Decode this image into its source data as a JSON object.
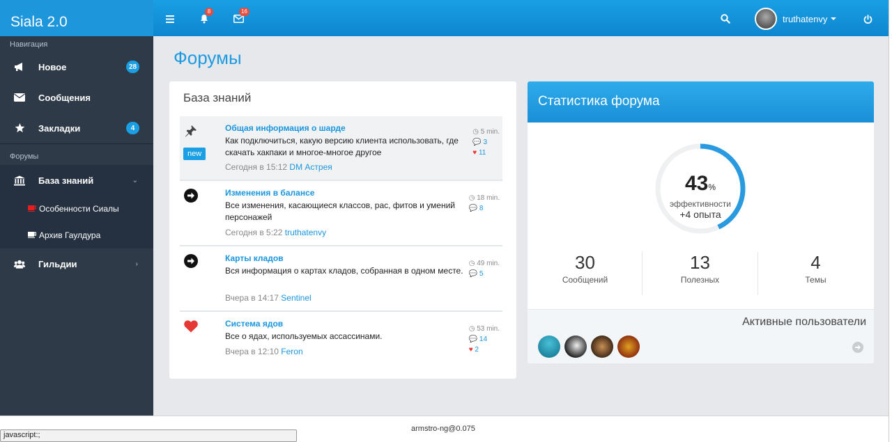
{
  "brand": "Siala 2.0",
  "topbar": {
    "notifications_count": "8",
    "messages_count": "16",
    "username": "truthatenvy"
  },
  "sidebar": {
    "nav_heading": "Навигация",
    "items": [
      {
        "label": "Новое",
        "badge": "28"
      },
      {
        "label": "Сообщения"
      },
      {
        "label": "Закладки",
        "badge": "4"
      }
    ],
    "forums_heading": "Форумы",
    "knowledge": "База знаний",
    "subitems": [
      "Особенности Сиалы",
      "Архив Гаулдура"
    ],
    "guilds": "Гильдии"
  },
  "page_title": "Форумы",
  "panel": {
    "title": "База знаний",
    "new_label": "new",
    "topics": [
      {
        "title": "Общая информация о шарде",
        "desc": "Как подключиться, какую версию клиента использовать, где скачать хакпаки и многое-многое другое",
        "time": "Сегодня в 15:12",
        "author": "DM Астрея",
        "ago": "5 min.",
        "replies": "3",
        "likes": "11"
      },
      {
        "title": "Изменения в балансе",
        "desc": "Все изменения, касающиеся классов, рас, фитов и умений персонажей",
        "time": "Сегодня в 5:22",
        "author": "truthatenvy",
        "ago": "18 min.",
        "replies": "8"
      },
      {
        "title": "Карты кладов",
        "desc": "Вся информация о картах кладов, собранная в одном месте.",
        "time": "Вчера в 14:17",
        "author": "Sentinel",
        "ago": "49 min.",
        "replies": "5"
      },
      {
        "title": "Система ядов",
        "desc": "Все о ядах, используемых ассассинами.",
        "time": "Вчера в 12:10",
        "author": "Feron",
        "ago": "53 min.",
        "replies": "14",
        "likes": "2"
      }
    ]
  },
  "stats": {
    "title": "Статистика форума",
    "percent": "43",
    "percent_sign": "%",
    "progress": 0.43,
    "efficiency_label": "эффективности",
    "bonus": "+4 опыта",
    "columns": [
      {
        "value": "30",
        "label": "Сообщений"
      },
      {
        "value": "13",
        "label": "Полезных"
      },
      {
        "value": "4",
        "label": "Темы"
      }
    ],
    "active_title": "Активные пользователи"
  },
  "status": {
    "left": "javascript:;",
    "center": "armstro-ng@0.075"
  },
  "colors": {
    "accent": "#1a9fe4",
    "sidebar": "#2e3a48",
    "heart": "#e53935"
  }
}
